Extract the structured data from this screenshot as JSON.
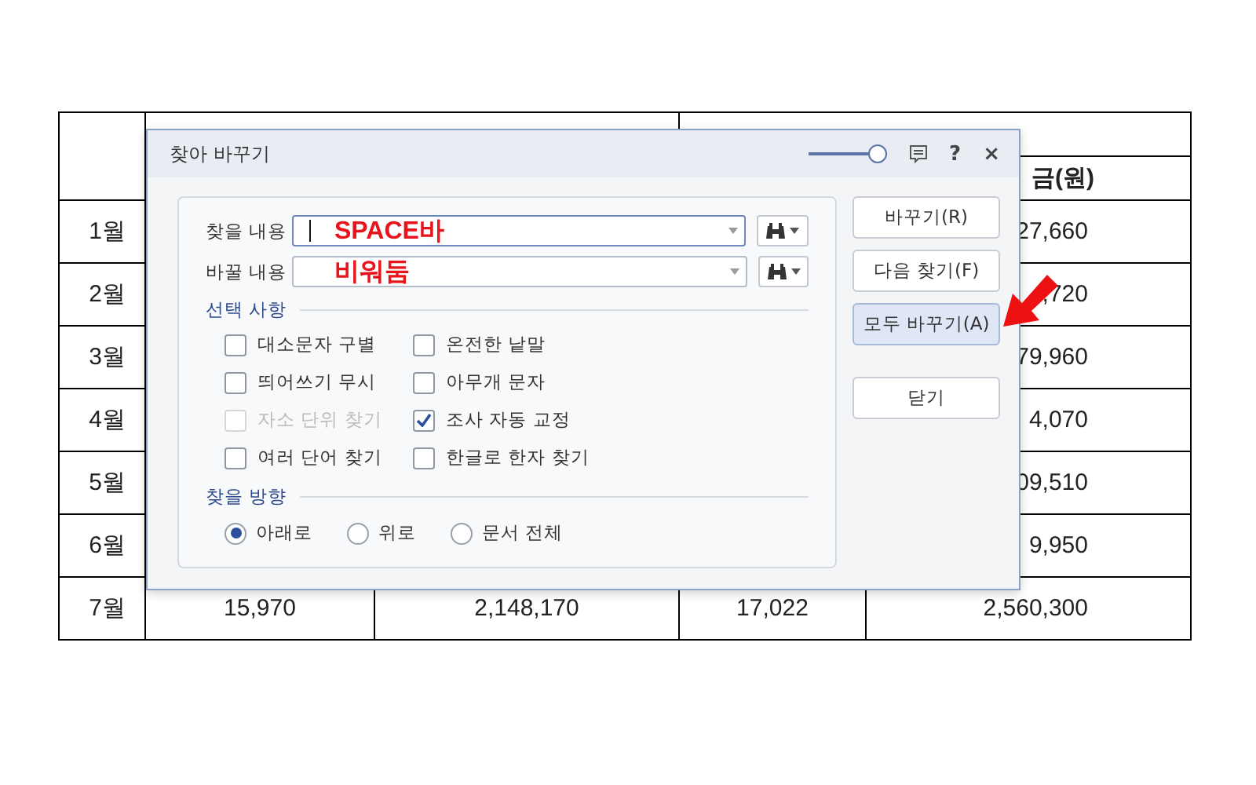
{
  "table": {
    "column_4_header": "금(원)",
    "rows": [
      {
        "month": "1월",
        "column_4": "27,660"
      },
      {
        "month": "2월",
        "column_4": ",720"
      },
      {
        "month": "3월",
        "column_4": "79,960"
      },
      {
        "month": "4월",
        "column_4": "4,070"
      },
      {
        "month": "5월",
        "column_4": "09,510"
      },
      {
        "month": "6월",
        "column_4": "9,950"
      },
      {
        "month": "7월",
        "column_1": "15,970",
        "column_2": "2,148,170",
        "column_3": "17,022",
        "column_4": "2,560,300"
      }
    ]
  },
  "dialog": {
    "title": "찾아 바꾸기",
    "opacity_slider": {
      "level": 1
    },
    "help": "?",
    "close": "×",
    "fields": [
      {
        "label": "찾을 내용",
        "value": "SPACE바",
        "focused": true
      },
      {
        "label": "바꿀 내용",
        "value": "비워둠",
        "focused": false
      }
    ],
    "options_title": "선택 사항",
    "options": [
      {
        "label": "대소문자 구별",
        "checked": false,
        "disabled": false
      },
      {
        "label": "온전한 낱말",
        "checked": false,
        "disabled": false
      },
      {
        "label": "띄어쓰기 무시",
        "checked": false,
        "disabled": false
      },
      {
        "label": "아무개 문자",
        "checked": false,
        "disabled": false
      },
      {
        "label": "자소 단위 찾기",
        "checked": false,
        "disabled": true
      },
      {
        "label": "조사 자동 교정",
        "checked": true,
        "disabled": false
      },
      {
        "label": "여러 단어 찾기",
        "checked": false,
        "disabled": false
      },
      {
        "label": "한글로 한자 찾기",
        "checked": false,
        "disabled": false
      }
    ],
    "direction_title": "찾을 방향",
    "directions": [
      {
        "label": "아래로",
        "selected": true
      },
      {
        "label": "위로",
        "selected": false
      },
      {
        "label": "문서 전체",
        "selected": false
      }
    ],
    "buttons": [
      {
        "label": "바꾸기(R)",
        "focused": false
      },
      {
        "label": "다음 찾기(F)",
        "focused": false
      },
      {
        "label": "모두 바꾸기(A)",
        "focused": true
      },
      {
        "label": "닫기",
        "focused": false
      }
    ]
  }
}
